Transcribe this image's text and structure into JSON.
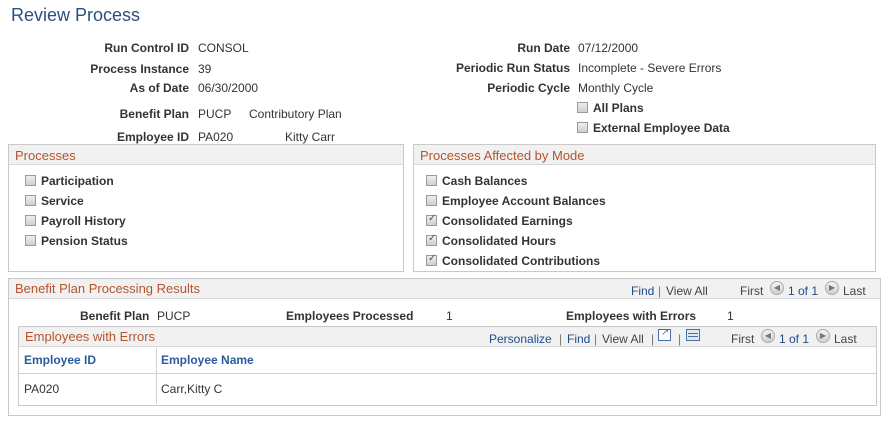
{
  "page": {
    "title": "Review Process"
  },
  "header": {
    "left": [
      {
        "label": "Run Control ID",
        "value": "CONSOL"
      },
      {
        "label": "Process Instance",
        "value": "39"
      },
      {
        "label": "As of Date",
        "value": "06/30/2000"
      },
      {
        "label": "Benefit Plan",
        "value": "PUCP",
        "extra": "Contributory Plan"
      },
      {
        "label": "Employee ID",
        "value": "PA020",
        "extra": "Kitty Carr"
      }
    ],
    "right": [
      {
        "label": "Run Date",
        "value": "07/12/2000"
      },
      {
        "label": "Periodic Run Status",
        "value": "Incomplete - Severe Errors"
      },
      {
        "label": "Periodic Cycle",
        "value": "Monthly Cycle"
      }
    ],
    "right_checks": [
      {
        "label": "All Plans",
        "checked": false
      },
      {
        "label": "External Employee Data",
        "checked": false
      }
    ]
  },
  "processes": {
    "title": "Processes",
    "items": [
      {
        "label": "Participation",
        "checked": false
      },
      {
        "label": "Service",
        "checked": false
      },
      {
        "label": "Payroll History",
        "checked": false
      },
      {
        "label": "Pension Status",
        "checked": false
      }
    ]
  },
  "affected": {
    "title": "Processes Affected by Mode",
    "items": [
      {
        "label": "Cash Balances",
        "checked": false
      },
      {
        "label": "Employee Account Balances",
        "checked": false
      },
      {
        "label": "Consolidated Earnings",
        "checked": true
      },
      {
        "label": "Consolidated Hours",
        "checked": true
      },
      {
        "label": "Consolidated Contributions",
        "checked": true
      }
    ]
  },
  "results": {
    "title": "Benefit Plan Processing Results",
    "find": "Find",
    "sep": "|",
    "view_all": "View All",
    "first": "First",
    "range": "1 of 1",
    "last": "Last",
    "benefit_plan_label": "Benefit Plan",
    "benefit_plan_value": "PUCP",
    "emp_processed_label": "Employees Processed",
    "emp_processed_value": "1",
    "emp_errors_label": "Employees with Errors",
    "emp_errors_value": "1"
  },
  "errors_grid": {
    "title": "Employees with Errors",
    "personalize": "Personalize",
    "find": "Find",
    "sep": "|",
    "view_all": "View All",
    "first": "First",
    "range": "1 of 1",
    "last": "Last",
    "columns": [
      "Employee ID",
      "Employee Name"
    ],
    "rows": [
      [
        "PA020",
        "Carr,Kitty C"
      ]
    ]
  }
}
